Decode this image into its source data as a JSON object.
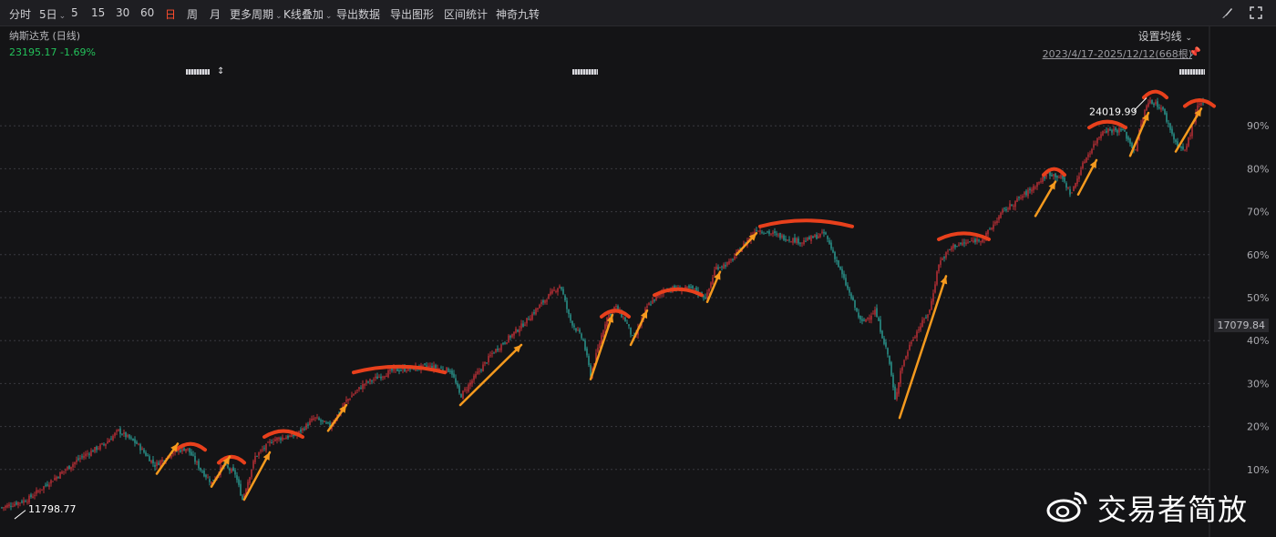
{
  "toolbar": {
    "items": [
      {
        "label": "分时",
        "active": false,
        "dropdown": false
      },
      {
        "label": "5日",
        "active": false,
        "dropdown": true
      },
      {
        "label": "5",
        "active": false,
        "dropdown": false
      },
      {
        "label": "15",
        "active": false,
        "dropdown": false
      },
      {
        "label": "30",
        "active": false,
        "dropdown": false
      },
      {
        "label": "60",
        "active": false,
        "dropdown": false
      },
      {
        "label": "日",
        "active": true,
        "dropdown": false
      },
      {
        "label": "周",
        "active": false,
        "dropdown": false
      },
      {
        "label": "月",
        "active": false,
        "dropdown": false
      },
      {
        "label": "更多周期",
        "active": false,
        "dropdown": true
      },
      {
        "label": "K线叠加",
        "active": false,
        "dropdown": true
      },
      {
        "label": "导出数据",
        "active": false,
        "dropdown": false
      },
      {
        "label": "导出图形",
        "active": false,
        "dropdown": false
      },
      {
        "label": "区间统计",
        "active": false,
        "dropdown": false
      },
      {
        "label": "神奇九转",
        "active": false,
        "dropdown": false
      }
    ],
    "right_icons": [
      "brush-icon",
      "expand-icon"
    ]
  },
  "info": {
    "index_name": "纳斯达克 (日线)",
    "last_quote": "23195.17  -1.69%",
    "ma_setting": "设置均线",
    "date_range": "2023/4/17-2025/12/12(668根)"
  },
  "colors": {
    "up": "#e5363f",
    "down": "#2fb7ad",
    "annotation_arc": "#e8401c",
    "annotation_arrow": "#f59a1e",
    "quote": "#23c15a"
  },
  "watermark": {
    "text": "交易者简放",
    "icon": "weibo-icon"
  },
  "chart_data": {
    "type": "candlestick",
    "bars": 668,
    "date_range": "2023/4/17-2025/12/12",
    "period": "daily",
    "axis_right": {
      "ticks": [
        "10%",
        "20%",
        "30%",
        "40%",
        "50%",
        "60%",
        "70%",
        "80%",
        "90%"
      ],
      "scale": "percent change from period low"
    },
    "price_low": 11798.77,
    "price_high": 24019.99,
    "last_close": 23195.17,
    "last_change_pct": -1.69,
    "current_price_tag": "17079.84",
    "low_label": "11798.77",
    "high_label": "24019.99",
    "grid": true,
    "path_pct": [
      [
        0,
        1
      ],
      [
        30,
        3
      ],
      [
        60,
        8
      ],
      [
        90,
        13
      ],
      [
        115,
        16
      ],
      [
        130,
        19
      ],
      [
        150,
        16
      ],
      [
        170,
        11
      ],
      [
        190,
        14
      ],
      [
        205,
        15
      ],
      [
        220,
        10
      ],
      [
        232,
        7
      ],
      [
        245,
        11
      ],
      [
        258,
        9
      ],
      [
        266,
        3
      ],
      [
        280,
        13
      ],
      [
        300,
        17
      ],
      [
        325,
        18
      ],
      [
        345,
        22
      ],
      [
        362,
        20
      ],
      [
        380,
        26
      ],
      [
        400,
        30
      ],
      [
        430,
        33
      ],
      [
        470,
        34
      ],
      [
        495,
        33
      ],
      [
        505,
        27
      ],
      [
        540,
        37
      ],
      [
        575,
        44
      ],
      [
        600,
        50
      ],
      [
        615,
        53
      ],
      [
        625,
        45
      ],
      [
        640,
        40
      ],
      [
        648,
        32
      ],
      [
        665,
        45
      ],
      [
        675,
        48
      ],
      [
        688,
        44
      ],
      [
        695,
        40
      ],
      [
        710,
        48
      ],
      [
        730,
        52
      ],
      [
        760,
        52
      ],
      [
        775,
        50
      ],
      [
        785,
        57
      ],
      [
        800,
        58
      ],
      [
        815,
        62
      ],
      [
        830,
        66
      ],
      [
        860,
        64
      ],
      [
        880,
        63
      ],
      [
        905,
        65
      ],
      [
        915,
        60
      ],
      [
        930,
        52
      ],
      [
        945,
        44
      ],
      [
        960,
        47
      ],
      [
        975,
        36
      ],
      [
        982,
        26
      ],
      [
        988,
        33
      ],
      [
        1000,
        40
      ],
      [
        1020,
        47
      ],
      [
        1030,
        58
      ],
      [
        1045,
        62
      ],
      [
        1065,
        63
      ],
      [
        1080,
        64
      ],
      [
        1100,
        70
      ],
      [
        1130,
        75
      ],
      [
        1150,
        79
      ],
      [
        1165,
        78
      ],
      [
        1175,
        74
      ],
      [
        1190,
        82
      ],
      [
        1210,
        89
      ],
      [
        1232,
        89
      ],
      [
        1245,
        84
      ],
      [
        1255,
        93
      ],
      [
        1262,
        96
      ],
      [
        1275,
        94
      ],
      [
        1290,
        86
      ],
      [
        1300,
        84
      ],
      [
        1315,
        95
      ],
      [
        1325,
        95
      ]
    ],
    "annotations": {
      "arcs": [
        [
          193,
          225,
          15
        ],
        [
          240,
          268,
          12
        ],
        [
          290,
          332,
          18
        ],
        [
          388,
          488,
          33
        ],
        [
          660,
          690,
          46
        ],
        [
          718,
          770,
          51
        ],
        [
          834,
          935,
          67
        ],
        [
          1030,
          1085,
          64
        ],
        [
          1145,
          1168,
          79
        ],
        [
          1195,
          1235,
          90
        ],
        [
          1255,
          1280,
          97
        ],
        [
          1300,
          1332,
          95
        ]
      ],
      "arrows": [
        [
          172,
          9,
          195,
          16
        ],
        [
          232,
          6,
          252,
          13
        ],
        [
          268,
          3,
          296,
          14
        ],
        [
          360,
          19,
          380,
          25
        ],
        [
          505,
          25,
          572,
          39
        ],
        [
          648,
          31,
          672,
          46
        ],
        [
          692,
          39,
          710,
          47
        ],
        [
          776,
          49,
          790,
          56
        ],
        [
          808,
          60,
          830,
          65
        ],
        [
          987,
          22,
          1038,
          55
        ],
        [
          1136,
          69,
          1158,
          77
        ],
        [
          1183,
          74,
          1203,
          82
        ],
        [
          1240,
          83,
          1260,
          93
        ],
        [
          1290,
          84,
          1318,
          94
        ]
      ]
    }
  }
}
